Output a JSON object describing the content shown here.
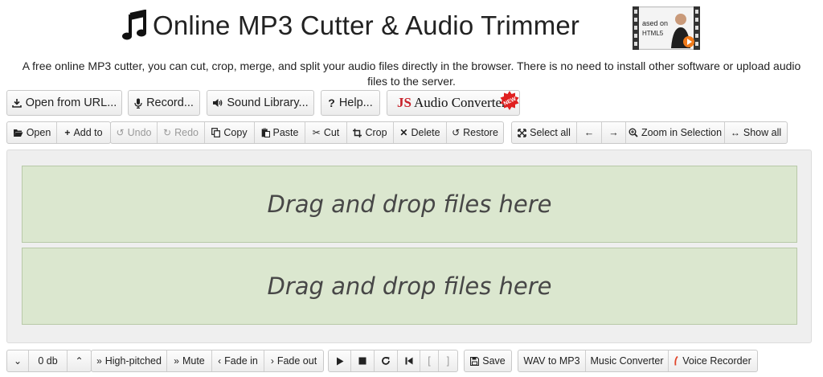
{
  "header": {
    "title": "Online MP3 Cutter & Audio Trimmer",
    "music_icon": "music-note-icon",
    "video_caption": "ased on HTML5"
  },
  "description": "A free online MP3 cutter, you can cut, crop, merge, and split your audio files directly in the browser. There is no need to install other software or upload audio files to the server.",
  "top_buttons": {
    "open_url": "Open from URL...",
    "record": "Record...",
    "sound_library": "Sound Library...",
    "help": "Help...",
    "js_converter_js": "JS",
    "js_converter_label": "Audio Converter",
    "new_badge": "NEW"
  },
  "toolbar": {
    "open": "Open",
    "add_to": "Add to",
    "undo": "Undo",
    "redo": "Redo",
    "copy": "Copy",
    "paste": "Paste",
    "cut": "Cut",
    "crop": "Crop",
    "delete": "Delete",
    "restore": "Restore",
    "select_all": "Select all",
    "left_arrow": "←",
    "right_arrow": "→",
    "zoom_in_selection": "Zoom in Selection",
    "show_all": "Show all"
  },
  "dropzones": {
    "primary": "Drag and drop files here",
    "secondary": "Drag and drop files here"
  },
  "bottom_bar": {
    "volume_value": "0 db",
    "high_pitched": "High-pitched",
    "mute": "Mute",
    "fade_in": "Fade in",
    "fade_out": "Fade out",
    "bracket_open": "[",
    "bracket_close": "]",
    "save": "Save",
    "wav_to_mp3": "WAV to MP3",
    "music_converter": "Music Converter",
    "voice_recorder": "Voice Recorder"
  },
  "colors": {
    "dropzone_bg": "#dbe7cf",
    "js_red": "#c8202a"
  }
}
